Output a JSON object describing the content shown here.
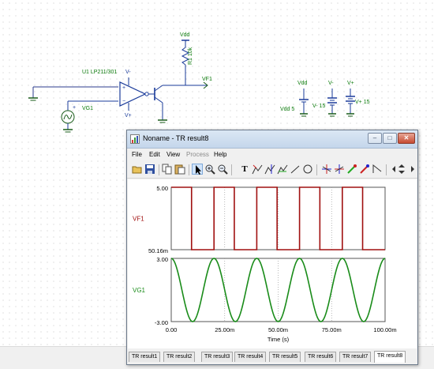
{
  "schematic": {
    "opamp_label": "U1 LP211/301",
    "opamp_vminus": "V-",
    "opamp_vplus": "V+",
    "vdd_top": "Vdd",
    "resistor_label": "R1 10k",
    "output_label": "VF1",
    "generator_label": "VG1",
    "supplies": [
      {
        "top": "Vdd",
        "value": "Vdd 5"
      },
      {
        "top": "V-",
        "value": "V- 15"
      },
      {
        "top": "V+",
        "value": "V+ 15"
      }
    ]
  },
  "window": {
    "title": "Noname - TR result8",
    "controls": {
      "minimize": "–",
      "maximize": "□",
      "close": "✕"
    },
    "menu": [
      "File",
      "Edit",
      "View",
      "Process",
      "Help"
    ],
    "disabled_menu": "Process",
    "toolbar_icons": [
      "open-icon",
      "save-icon",
      "copy-icon",
      "paste-icon",
      "pointer-icon",
      "zoom-in-icon",
      "zoom-out-icon",
      "text-icon",
      "cursor-a-icon",
      "cursor-b-icon",
      "cursor-c-icon",
      "line-icon",
      "circle-icon",
      "marker-icon",
      "marker2-icon",
      "pen-icon",
      "pen2-icon",
      "curve-icon",
      "arrow-left-icon",
      "arrows-ud-icon",
      "arrow-right-icon"
    ],
    "toolbar_text": "T"
  },
  "tabs": [
    "TR result1",
    "TR result2",
    "TR result3",
    "TR result4",
    "TR result5",
    "TR result6",
    "TR result7",
    "TR result8"
  ],
  "active_tab": "TR result8",
  "colors": {
    "vf1": "#a01010",
    "vg1": "#1a8c1a",
    "schematic_text": "#0a7a0a"
  },
  "chart_data": [
    {
      "type": "line",
      "name": "VF1",
      "ylabel": "VF1",
      "y_tick_labels": [
        "5.00",
        "50.16m"
      ],
      "ylim": [
        0.05016,
        5.0
      ],
      "x_tick_labels": [
        "0.00",
        "25.00m",
        "50.00m",
        "75.00m",
        "100.00m"
      ],
      "xlabel": "Time (s)",
      "xlim": [
        0,
        0.1
      ],
      "x": [
        0,
        0,
        0.0095,
        0.0095,
        0.02,
        0.02,
        0.0295,
        0.0295,
        0.04,
        0.04,
        0.0495,
        0.0495,
        0.06,
        0.06,
        0.0695,
        0.0695,
        0.08,
        0.08,
        0.0895,
        0.0895,
        0.1
      ],
      "y": [
        5.0,
        5.0,
        5.0,
        0.05016,
        0.05016,
        5.0,
        5.0,
        0.05016,
        0.05016,
        5.0,
        5.0,
        0.05016,
        0.05016,
        5.0,
        5.0,
        0.05016,
        0.05016,
        5.0,
        5.0,
        0.05016,
        0.05016
      ],
      "grid": true
    },
    {
      "type": "line",
      "name": "VG1",
      "ylabel": "VG1",
      "y_tick_labels": [
        "3.00",
        "-3.00"
      ],
      "ylim": [
        -3.0,
        3.0
      ],
      "x_tick_labels": [
        "0.00",
        "25.00m",
        "50.00m",
        "75.00m",
        "100.00m"
      ],
      "xlabel": "Time (s)",
      "xlim": [
        0,
        0.1
      ],
      "waveform": "sine",
      "amplitude": 3.0,
      "frequency_hz": 50,
      "phase_deg": 90,
      "grid": true
    }
  ]
}
